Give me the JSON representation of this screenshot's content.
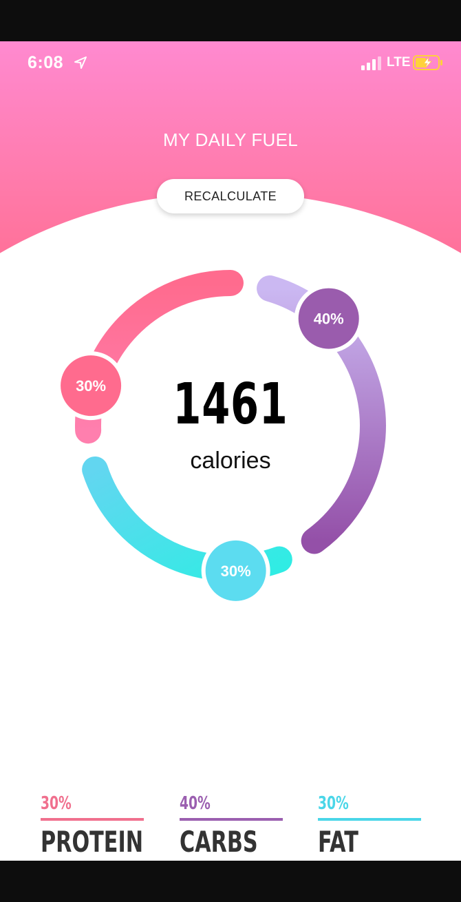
{
  "status_bar": {
    "time": "6:08",
    "network": "LTE"
  },
  "header": {
    "title": "MY DAILY FUEL",
    "recalculate_label": "RECALCULATE"
  },
  "summary": {
    "calories_value": "1461",
    "calories_label": "calories"
  },
  "chart_data": {
    "type": "donut",
    "total": 1461,
    "segments": [
      {
        "label": "30%",
        "value": 30,
        "color": "#ff6b8e"
      },
      {
        "label": "40%",
        "value": 40,
        "color": "#9b5fb0"
      },
      {
        "label": "30%",
        "value": 30,
        "color": "#4ee0ee"
      }
    ]
  },
  "macros": [
    {
      "pct": "30%",
      "name": "PROTEIN",
      "color": "#f0708e"
    },
    {
      "pct": "40%",
      "name": "CARBS",
      "color": "#9b5fb0"
    },
    {
      "pct": "30%",
      "name": "FAT",
      "color": "#4ad6e8"
    }
  ],
  "colors": {
    "header_top": "#ff8ad0",
    "header_bottom": "#ff6b8e"
  }
}
